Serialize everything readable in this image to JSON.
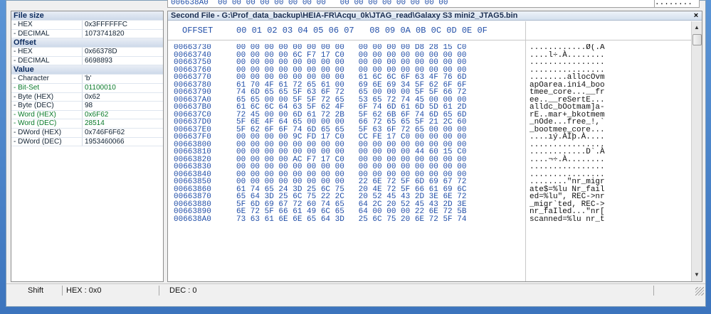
{
  "top_strip": {
    "addr": "006638A0",
    "hex": "00 00 00 00 00 00 00 00   00 00 00 00 00 00 00 00",
    "ascii": "........"
  },
  "left_panel": {
    "sections": [
      {
        "header": "File size",
        "rows": [
          {
            "key": "- HEX",
            "value": "0x3FFFFFFC",
            "green": false
          },
          {
            "key": "- DECIMAL",
            "value": "1073741820",
            "green": false
          }
        ]
      },
      {
        "header": "Offset",
        "rows": [
          {
            "key": "- HEX",
            "value": "0x66378D",
            "green": false
          },
          {
            "key": "- DECIMAL",
            "value": "6698893",
            "green": false
          }
        ]
      },
      {
        "header": "Value",
        "rows": [
          {
            "key": "- Character",
            "value": "'b'",
            "green": false
          },
          {
            "key": "- Bit-Set",
            "value": "01100010",
            "green": true
          },
          {
            "key": "- Byte (HEX)",
            "value": "0x62",
            "green": false
          },
          {
            "key": "- Byte (DEC)",
            "value": "98",
            "green": false
          },
          {
            "key": "- Word (HEX)",
            "value": "0x6F62",
            "green": true
          },
          {
            "key": "- Word (DEC)",
            "value": "28514",
            "green": true
          },
          {
            "key": "- DWord (HEX)",
            "value": "0x746F6F62",
            "green": false
          },
          {
            "key": "- DWord (DEC)",
            "value": "1953460066",
            "green": false
          }
        ]
      }
    ]
  },
  "pane": {
    "title": "Second File - G:\\Prof_data_backup\\HEIA-FR\\Acqu_0k\\JTAG_read\\Galaxy S3 mini2_JTAG5.bin",
    "close_label": "×",
    "offset_header": "OFFSET",
    "byte_header": "00 01 02 03 04 05 06 07   08 09 0A 0B 0C 0D 0E 0F"
  },
  "rows": [
    {
      "addr": "00663730",
      "hex": "00 00 00 00 00 00 00 00   00 00 00 00 D8 28 15 C0",
      "ascii": "............Ø(.À"
    },
    {
      "addr": "00663740",
      "hex": "00 00 00 00 6C F7 17 C0   00 00 00 00 00 00 00 00",
      "ascii": "....l÷.À........"
    },
    {
      "addr": "00663750",
      "hex": "00 00 00 00 00 00 00 00   00 00 00 00 00 00 00 00",
      "ascii": "................"
    },
    {
      "addr": "00663760",
      "hex": "00 00 00 00 00 00 00 00   00 00 00 00 00 00 00 00",
      "ascii": "................"
    },
    {
      "addr": "00663770",
      "hex": "00 00 00 00 00 00 00 00   61 6C 6C 6F 63 4F 76 6D",
      "ascii": "........allocOvm"
    },
    {
      "addr": "00663780",
      "hex": "61 70 4F 61 72 65 61 00   69 6E 69 34 5F 62 6F 6F",
      "ascii": "apOarea.ini4_boo"
    },
    {
      "addr": "00663790",
      "hex": "74 6D 65 65 5F 63 6F 72   65 00 00 00 5F 5F 66 72",
      "ascii": "tmee_core...__fr"
    },
    {
      "addr": "006637A0",
      "hex": "65 65 00 00 5F 5F 72 65   53 65 72 74 45 00 00 00",
      "ascii": "ee..__reSertE..."
    },
    {
      "addr": "006637B0",
      "hex": "61 6C 6C 64 63 5F 62 4F   6F 74 6D 61 6D 5D 61 2D",
      "ascii": "alldc_bOotmam]a-"
    },
    {
      "addr": "006637C0",
      "hex": "72 45 00 00 6D 61 72 2B   5F 62 6B 6F 74 6D 65 6D",
      "ascii": "rE..mar+_bkotmem"
    },
    {
      "addr": "006637D0",
      "hex": "5F 6E 4F 64 65 00 00 00   66 72 65 65 5F 21 2C 60",
      "ascii": "_nOde...free_!,`"
    },
    {
      "addr": "006637E0",
      "hex": "5F 62 6F 6F 74 6D 65 65   5F 63 6F 72 65 00 00 00",
      "ascii": "_bootmee_core..."
    },
    {
      "addr": "006637F0",
      "hex": "00 00 00 00 9C FD 17 C0   CC FE 17 C0 00 00 00 00",
      "ascii": "....ıý.ÀÌþ.À...."
    },
    {
      "addr": "00663800",
      "hex": "00 00 00 00 00 00 00 00   00 00 00 00 00 00 00 00",
      "ascii": "................"
    },
    {
      "addr": "00663810",
      "hex": "00 00 00 00 00 00 00 00   00 00 00 00 44 60 15 C0",
      "ascii": "............D`.À"
    },
    {
      "addr": "00663820",
      "hex": "00 00 00 00 AC F7 17 C0   00 00 00 00 00 00 00 00",
      "ascii": "....¬÷.À........"
    },
    {
      "addr": "00663830",
      "hex": "00 00 00 00 00 00 00 00   00 00 00 00 00 00 00 00",
      "ascii": "................"
    },
    {
      "addr": "00663840",
      "hex": "00 00 00 00 00 00 00 00   00 00 00 00 00 00 00 00",
      "ascii": "................"
    },
    {
      "addr": "00663850",
      "hex": "00 00 00 00 00 00 00 00   22 6E 72 5F 6D 69 67 72",
      "ascii": "........\"nr_migr"
    },
    {
      "addr": "00663860",
      "hex": "61 74 65 24 3D 25 6C 75   20 4E 72 5F 66 61 69 6C",
      "ascii": "ate$=%lu Nr_fail"
    },
    {
      "addr": "00663870",
      "hex": "65 64 3D 25 6C 75 22 2C   20 52 45 43 2D 3E 6E 72",
      "ascii": "ed=%lu\", REC->nr"
    },
    {
      "addr": "00663880",
      "hex": "5F 6D 69 67 72 60 74 65   64 2C 20 52 45 43 2D 3E",
      "ascii": "_migr`ted, REC->"
    },
    {
      "addr": "00663890",
      "hex": "6E 72 5F 66 61 49 6C 65   64 00 00 00 22 6E 72 5B",
      "ascii": "nr_faIled...\"nr["
    },
    {
      "addr": "006638A0",
      "hex": "73 63 61 6E 6E 65 64 3D   25 6C 75 20 6E 72 5F 74",
      "ascii": "scanned=%lu nr_t"
    }
  ],
  "status": {
    "shift_label": "Shift",
    "hex_label": "HEX : 0x0",
    "dec_label": "DEC : 0"
  }
}
